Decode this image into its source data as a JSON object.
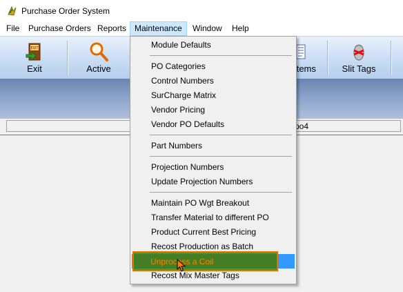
{
  "app": {
    "title": "Purchase Order System"
  },
  "menubar": {
    "items": [
      "File",
      "Purchase Orders",
      "Reports",
      "Maintenance",
      "Window",
      "Help"
    ],
    "active": "Maintenance"
  },
  "toolbar": {
    "buttons": [
      {
        "label": "Exit",
        "icon": "exit-door-icon"
      },
      {
        "label": "Active",
        "icon": "magnifier-icon"
      },
      {
        "label": "Items",
        "icon": "items-list-icon"
      },
      {
        "label": "Slit Tags",
        "icon": "slit-tags-icon"
      }
    ]
  },
  "status": {
    "text": "po4"
  },
  "maintenance_menu": {
    "groups": [
      [
        "Module Defaults"
      ],
      [
        "PO Categories",
        "Control Numbers",
        "SurCharge Matrix",
        "Vendor Pricing",
        "Vendor PO Defaults"
      ],
      [
        "Part Numbers"
      ],
      [
        "Projection Numbers",
        "Update Projection Numbers"
      ],
      [
        "Maintain PO Wgt Breakout",
        "Transfer Material to different PO",
        "Product Current Best Pricing",
        "Recost Production as Batch",
        "Unprocess a Coil",
        "Recost Mix Master Tags"
      ]
    ],
    "highlighted": "Unprocess a Coil"
  },
  "colors": {
    "menu_highlight": "#3399ff",
    "annotation_fill": "#467800",
    "annotation_border": "#e57200",
    "highlight_text": "#ff7f00"
  }
}
